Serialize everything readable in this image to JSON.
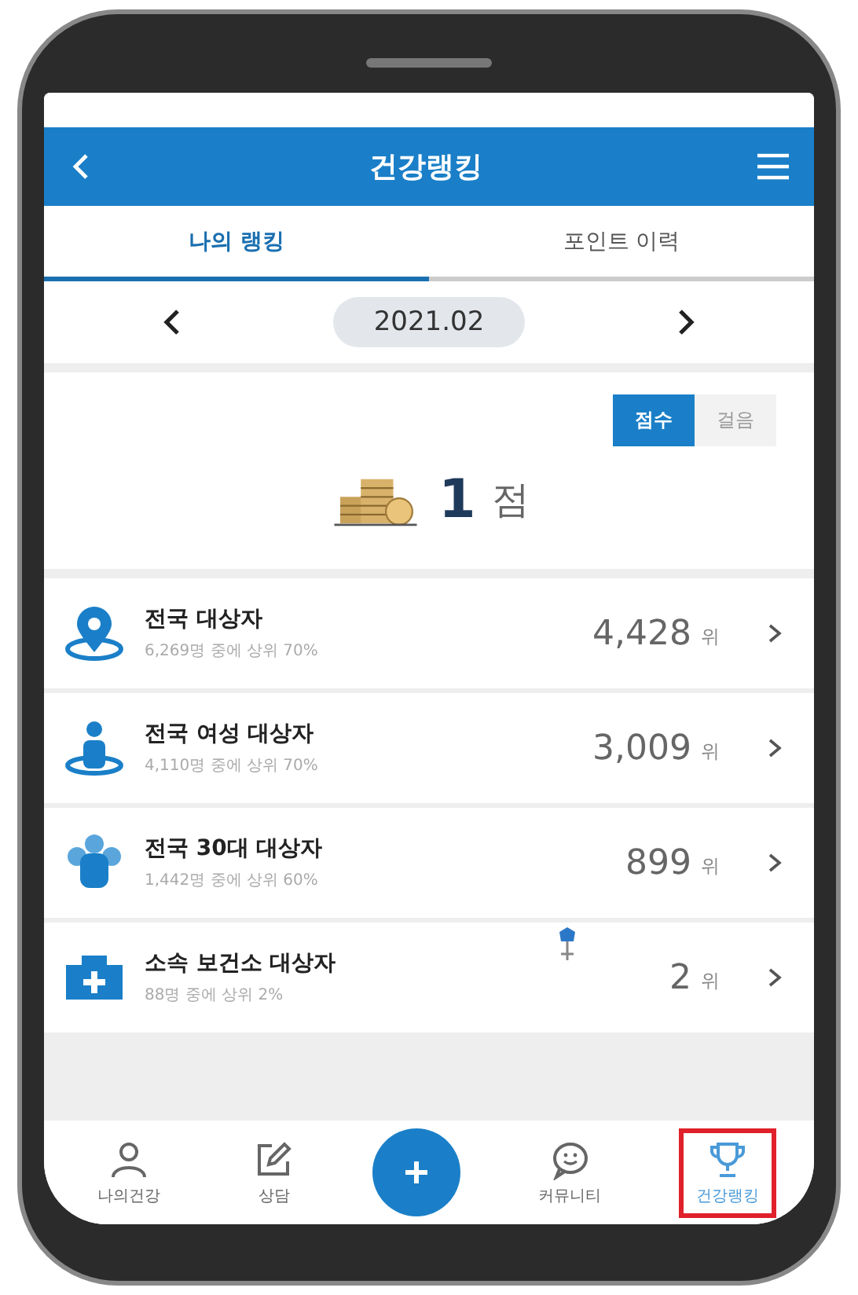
{
  "header": {
    "title": "건강랭킹"
  },
  "tabs": [
    {
      "label": "나의 랭킹",
      "selected": true
    },
    {
      "label": "포인트 이력",
      "selected": false
    }
  ],
  "period": {
    "value": "2021.02"
  },
  "mode_toggle": [
    {
      "label": "점수",
      "selected": true
    },
    {
      "label": "걸음",
      "selected": false
    }
  ],
  "score": {
    "value": "1",
    "unit": "점"
  },
  "rankings": [
    {
      "kind": "location",
      "title": "전국 대상자",
      "subtitle": "6,269명 중에 상위 70%",
      "rank": "4,428",
      "unit": "위"
    },
    {
      "kind": "person",
      "title": "전국 여성 대상자",
      "subtitle": "4,110명 중에 상위 70%",
      "rank": "3,009",
      "unit": "위"
    },
    {
      "kind": "group",
      "title": "전국 30대 대상자",
      "subtitle": "1,442명 중에 상위 60%",
      "rank": "899",
      "unit": "위"
    },
    {
      "kind": "clinic",
      "title": "소속 보건소 대상자",
      "subtitle": "88명 중에 상위 2%",
      "rank": "2",
      "unit": "위"
    }
  ],
  "bottom_nav": [
    {
      "kind": "person",
      "label": "나의건강",
      "selected": false,
      "highlighted": false
    },
    {
      "kind": "edit",
      "label": "상담",
      "selected": false,
      "highlighted": false
    },
    {
      "kind": "add"
    },
    {
      "kind": "chat",
      "label": "커뮤니티",
      "selected": false,
      "highlighted": false
    },
    {
      "kind": "trophy",
      "label": "건강랭킹",
      "selected": true,
      "highlighted": true
    }
  ]
}
